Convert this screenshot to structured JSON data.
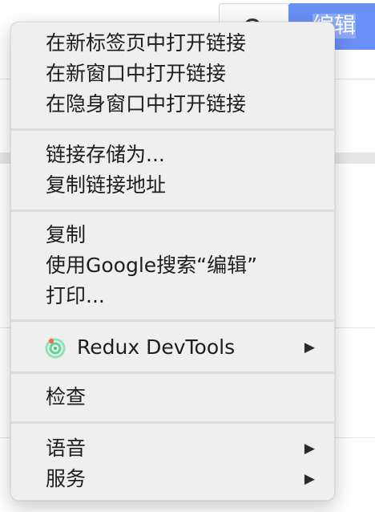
{
  "background": {
    "edit_button_label": "编辑"
  },
  "menu": {
    "group1": [
      {
        "label": "在新标签页中打开链接"
      },
      {
        "label": "在新窗口中打开链接"
      },
      {
        "label": "在隐身窗口中打开链接"
      }
    ],
    "group2": [
      {
        "label": "链接存储为..."
      },
      {
        "label": "复制链接地址"
      }
    ],
    "group3": [
      {
        "label": "复制"
      },
      {
        "label": "使用Google搜索“编辑”"
      },
      {
        "label": "打印..."
      }
    ],
    "group4": [
      {
        "label": "Redux DevTools",
        "icon": "redux-devtools-icon",
        "submenu_arrow": "▶"
      }
    ],
    "group5": [
      {
        "label": "检查"
      }
    ],
    "group6": [
      {
        "label": "语音",
        "submenu_arrow": "▶"
      },
      {
        "label": "服务",
        "submenu_arrow": "▶"
      }
    ]
  }
}
